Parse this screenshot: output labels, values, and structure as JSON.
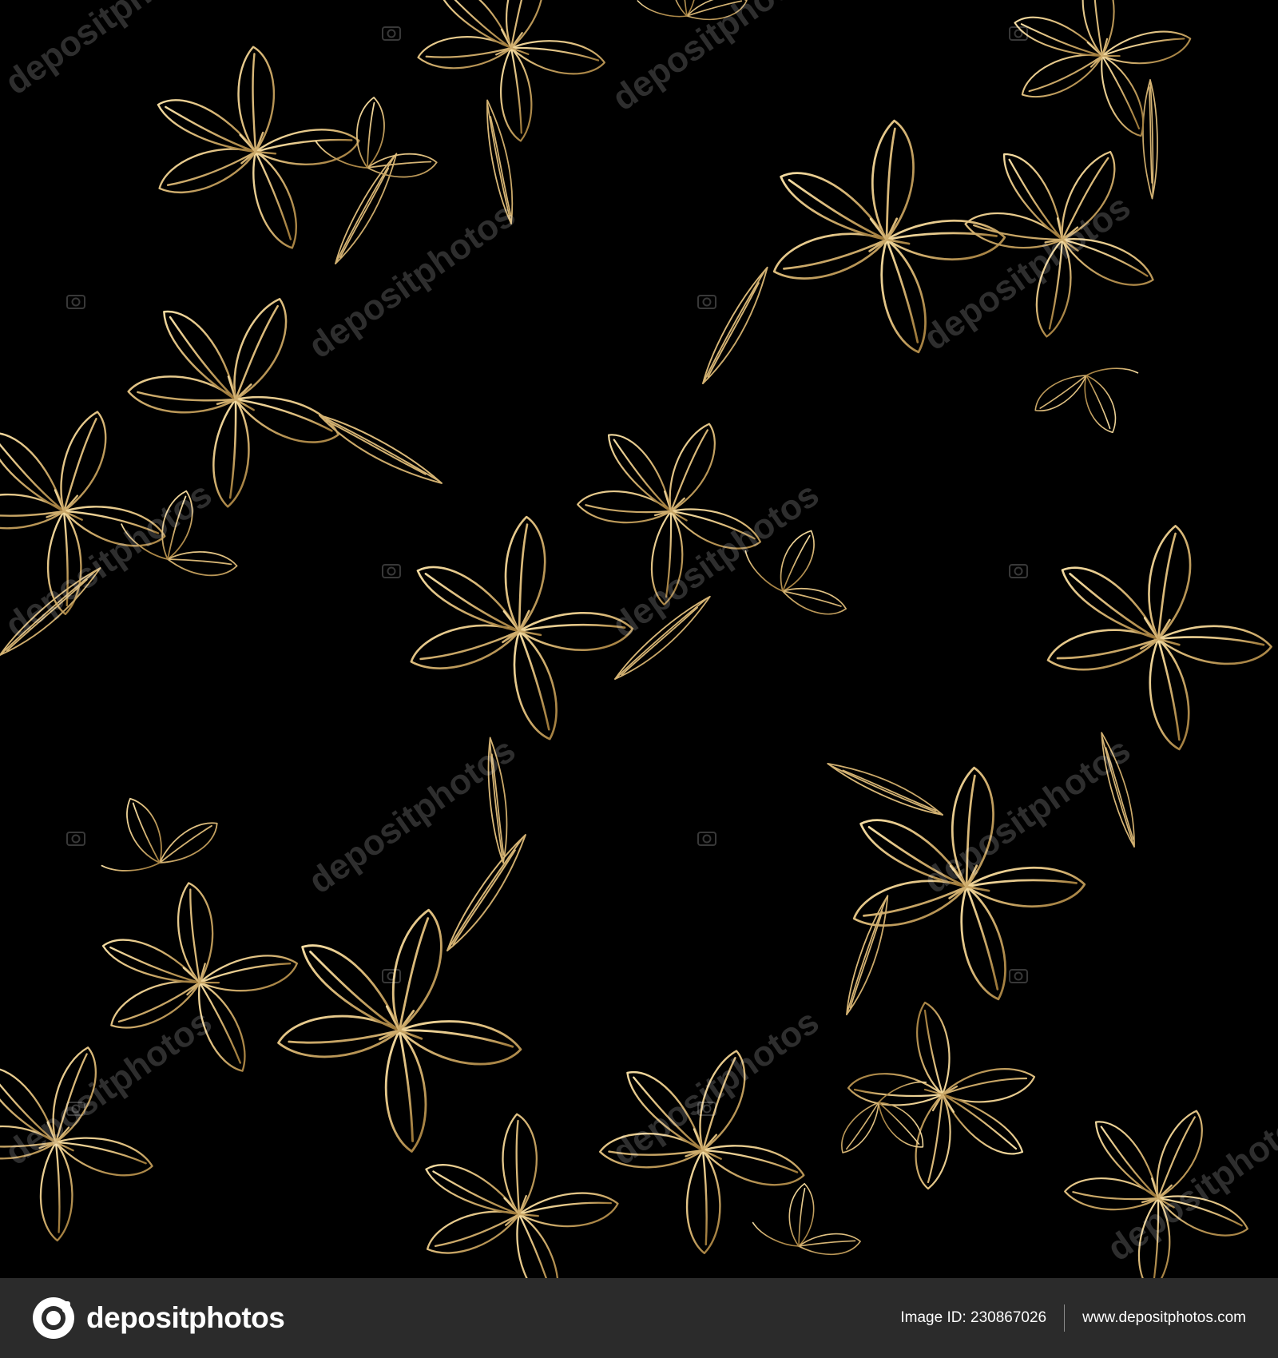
{
  "image": {
    "description_role": "seamless floral pattern",
    "background_color": "#000000",
    "line_color": "#d9b878",
    "line_color_dark": "#8a6a2e"
  },
  "watermark": {
    "text": "depositphotos",
    "icon": "camera-icon"
  },
  "footer": {
    "background_color": "#2b2b2b",
    "logo_icon": "depositphotos-logo-icon",
    "logo_text": "depositphotos",
    "image_id_label": "Image ID: 230867026",
    "website": "www.depositphotos.com"
  }
}
